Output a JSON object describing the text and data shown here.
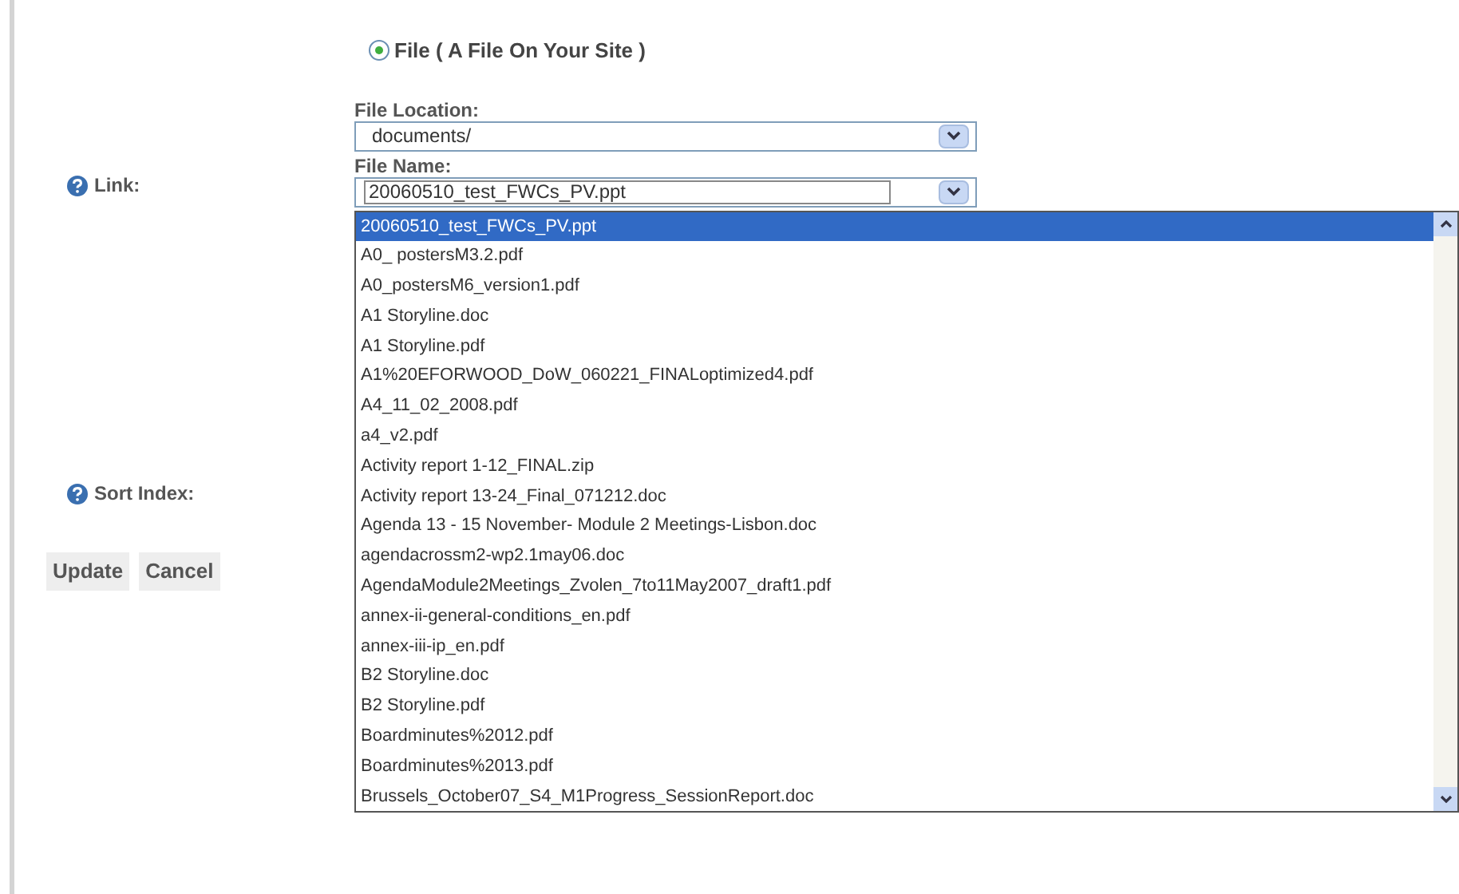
{
  "link_type": {
    "label": "File ( A File On Your Site )",
    "selected": true
  },
  "link": {
    "label": "Link:"
  },
  "file_location": {
    "label": "File Location:",
    "value": "documents/"
  },
  "file_name": {
    "label": "File Name:",
    "value": "20060510_test_FWCs_PV.ppt"
  },
  "file_list": [
    {
      "label": "20060510_test_FWCs_PV.ppt",
      "selected": true
    },
    {
      "label": "A0_ postersM3.2.pdf",
      "selected": false
    },
    {
      "label": "A0_postersM6_version1.pdf",
      "selected": false
    },
    {
      "label": "A1 Storyline.doc",
      "selected": false
    },
    {
      "label": "A1 Storyline.pdf",
      "selected": false
    },
    {
      "label": "A1%20EFORWOOD_DoW_060221_FINALoptimized4.pdf",
      "selected": false
    },
    {
      "label": "A4_11_02_2008.pdf",
      "selected": false
    },
    {
      "label": "a4_v2.pdf",
      "selected": false
    },
    {
      "label": "Activity report 1-12_FINAL.zip",
      "selected": false
    },
    {
      "label": "Activity report 13-24_Final_071212.doc",
      "selected": false
    },
    {
      "label": "Agenda 13 - 15 November- Module 2 Meetings-Lisbon.doc",
      "selected": false
    },
    {
      "label": "agendacrossm2-wp2.1may06.doc",
      "selected": false
    },
    {
      "label": "AgendaModule2Meetings_Zvolen_7to11May2007_draft1.pdf",
      "selected": false
    },
    {
      "label": "annex-ii-general-conditions_en.pdf",
      "selected": false
    },
    {
      "label": "annex-iii-ip_en.pdf",
      "selected": false
    },
    {
      "label": "B2 Storyline.doc",
      "selected": false
    },
    {
      "label": "B2 Storyline.pdf",
      "selected": false
    },
    {
      "label": "Boardminutes%2012.pdf",
      "selected": false
    },
    {
      "label": "Boardminutes%2013.pdf",
      "selected": false
    },
    {
      "label": "Brussels_October07_S4_M1Progress_SessionReport.doc",
      "selected": false
    }
  ],
  "sort_index": {
    "label": "Sort Index:"
  },
  "buttons": [
    "Update",
    "Cancel"
  ]
}
